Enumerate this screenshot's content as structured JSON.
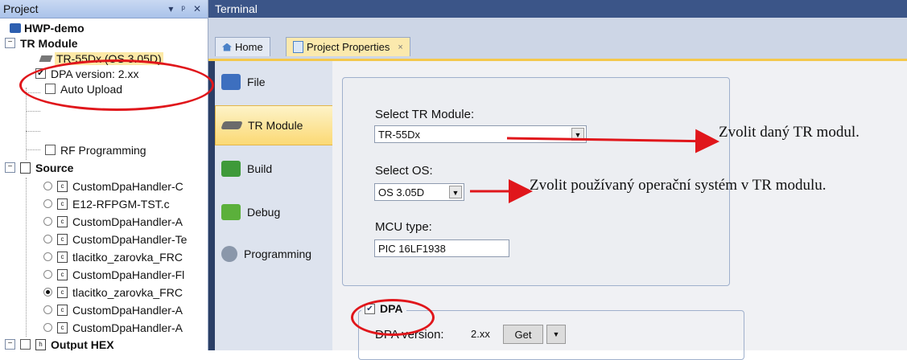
{
  "project_panel": {
    "title": "Project",
    "header_icons": [
      "▾",
      "ᵃ",
      "✕"
    ],
    "project_name": "HWP-demo",
    "tr_module_label": "TR Module",
    "tr_device": "TR-55Dx (OS 3.05D)",
    "dpa_version": "DPA version: 2.xx",
    "auto_upload": "Auto Upload",
    "rf_programming": "RF Programming",
    "source_label": "Source",
    "files": [
      "CustomDpaHandler-C",
      "E12-RFPGM-TST.c",
      "CustomDpaHandler-A",
      "CustomDpaHandler-Te",
      "tlacitko_zarovka_FRC",
      "CustomDpaHandler-Fl",
      "tlacitko_zarovka_FRC",
      "CustomDpaHandler-A",
      "CustomDpaHandler-A"
    ],
    "output_hex": "Output HEX"
  },
  "terminal": {
    "title": "Terminal"
  },
  "tabs": {
    "home": "Home",
    "project_properties": "Project Properties",
    "close": "×"
  },
  "nav": {
    "file": "File",
    "tr_module": "TR Module",
    "build": "Build",
    "debug": "Debug",
    "programming": "Programming"
  },
  "form": {
    "select_tr_label": "Select TR Module:",
    "select_tr_value": "TR-55Dx",
    "select_os_label": "Select OS:",
    "select_os_value": "OS 3.05D",
    "mcu_label": "MCU type:",
    "mcu_value": "PIC 16LF1938",
    "dpa_checkbox": "DPA",
    "dpa_version_label": "DPA version:",
    "dpa_version_value": "2.xx",
    "get_button": "Get"
  },
  "annotations": {
    "tr_module": "Zvolit daný TR modul.",
    "os": "Zvolit používaný operační systém v TR modulu."
  },
  "colors": {
    "annotation_red": "#e0161b",
    "selection": "#fbd974"
  }
}
